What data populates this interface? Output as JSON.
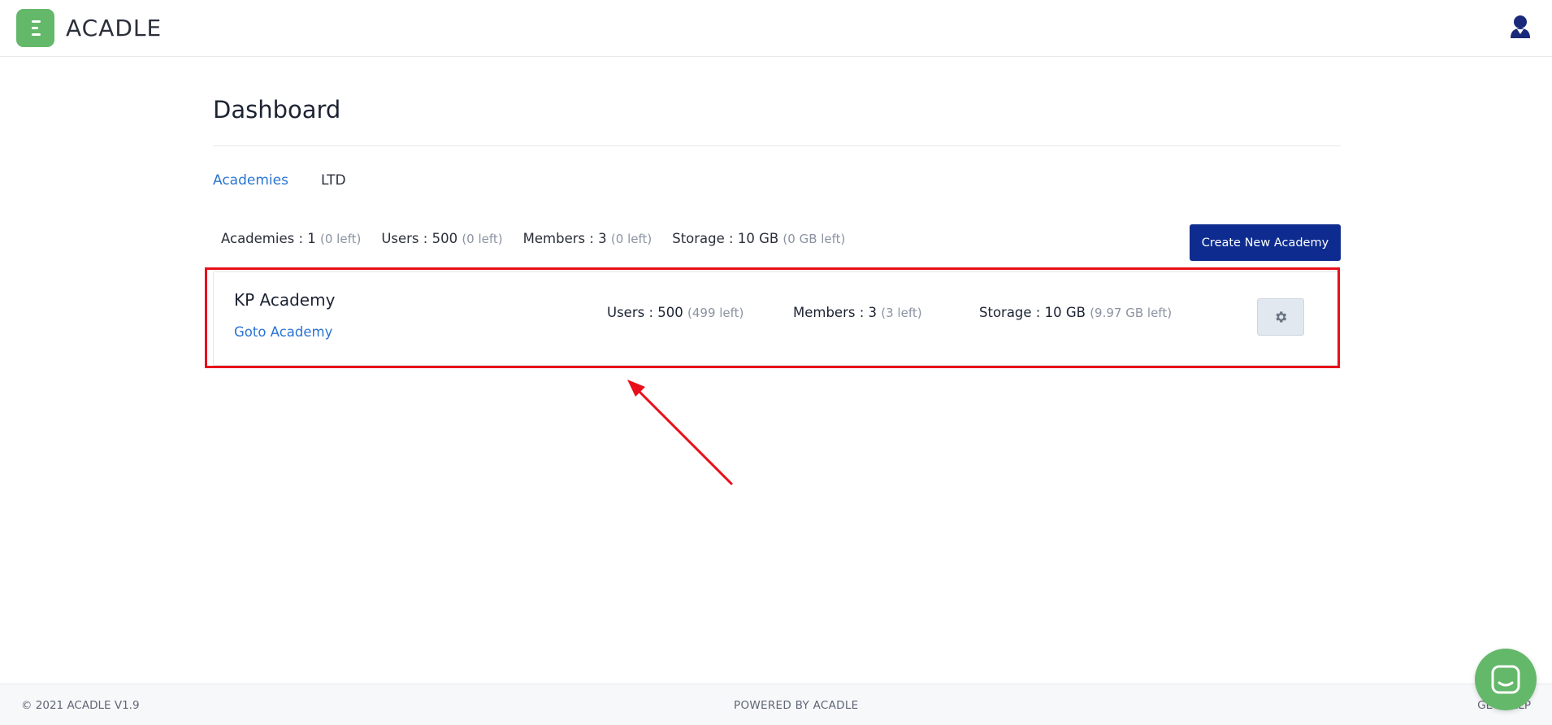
{
  "brand": {
    "name": "ACADLE"
  },
  "colors": {
    "accent": "#2a74d3",
    "primary_button": "#0e2c8f",
    "brand_green": "#64b86a",
    "annotation_red": "#e8101a"
  },
  "header": {
    "user_icon": "user-icon"
  },
  "page": {
    "title": "Dashboard"
  },
  "tabs": [
    {
      "label": "Academies",
      "active": true
    },
    {
      "label": "LTD",
      "active": false
    }
  ],
  "summary": {
    "academies": {
      "label": "Academies : 1",
      "left": "(0 left)"
    },
    "users": {
      "label": "Users : 500",
      "left": "(0 left)"
    },
    "members": {
      "label": "Members : 3",
      "left": "(0 left)"
    },
    "storage": {
      "label": "Storage : 10 GB",
      "left": "(0 GB left)"
    }
  },
  "actions": {
    "create_label": "Create New Academy"
  },
  "academy": {
    "name": "KP Academy",
    "link": "Goto Academy",
    "users": {
      "label": "Users : 500",
      "left": "(499 left)"
    },
    "members": {
      "label": "Members : 3",
      "left": "(3 left)"
    },
    "storage": {
      "label": "Storage : 10 GB",
      "left": "(9.97 GB left)"
    },
    "settings_icon": "gear-icon"
  },
  "footer": {
    "copyright": "© 2021 ACADLE V1.9",
    "powered": "POWERED BY ACADLE",
    "help": "GET HELP"
  }
}
